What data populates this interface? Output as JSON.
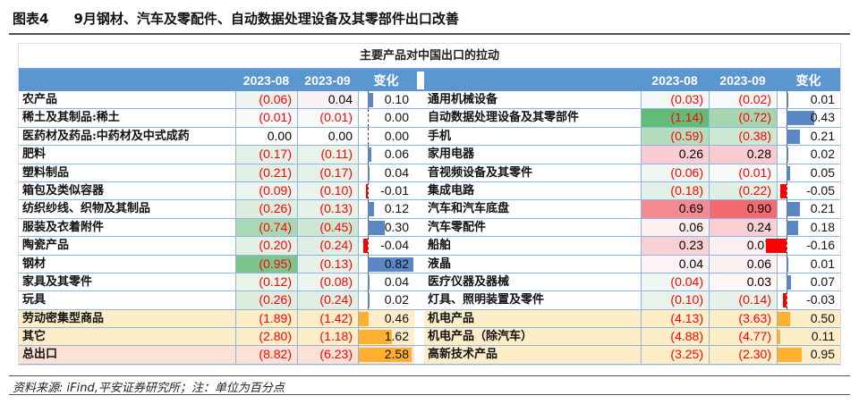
{
  "title": {
    "label": "图表4",
    "text": "9月钢材、汽车及零配件、自动数据处理设备及其零部件出口改善"
  },
  "footer": "资料来源: iFind,平安证券研究所；注：单位为百分点",
  "chart_data": {
    "type": "table",
    "title": "主要产品对中国出口的拉动",
    "columns": [
      "2023-08",
      "2023-09",
      "变化"
    ],
    "left": [
      {
        "name": "农产品",
        "v08": "(0.06)",
        "v09": "0.04",
        "chg": 0.1,
        "chg_text": "0.10",
        "bg08": "#eef5ef",
        "bg09": "#fdf2f3"
      },
      {
        "name": "稀土及其制品:稀土",
        "v08": "(0.01)",
        "v09": "(0.01)",
        "chg": 0.0,
        "chg_text": "0.00",
        "bg08": "#f7faf8",
        "bg09": "#f7faf8"
      },
      {
        "name": "医药材及药品:中药材及中式成药",
        "v08": "0.00",
        "v09": "0.00",
        "chg": 0.0,
        "chg_text": "0.00",
        "bg08": "#fff",
        "bg09": "#fff"
      },
      {
        "name": "肥料",
        "v08": "(0.17)",
        "v09": "(0.11)",
        "chg": 0.06,
        "chg_text": "0.06",
        "bg08": "#e4f1e7",
        "bg09": "#e8f3ea"
      },
      {
        "name": "塑料制品",
        "v08": "(0.21)",
        "v09": "(0.17)",
        "chg": 0.04,
        "chg_text": "0.04",
        "bg08": "#e2f0e5",
        "bg09": "#e4f1e7"
      },
      {
        "name": "箱包及类似容器",
        "v08": "(0.09)",
        "v09": "(0.10)",
        "chg": -0.01,
        "chg_text": "-0.01",
        "bg08": "#ebf4ed",
        "bg09": "#eaf3ec"
      },
      {
        "name": "纺织纱线、织物及其制品",
        "v08": "(0.26)",
        "v09": "(0.13)",
        "chg": 0.12,
        "chg_text": "0.12",
        "bg08": "#ddeee1",
        "bg09": "#e6f2e9"
      },
      {
        "name": "服装及衣着附件",
        "v08": "(0.74)",
        "v09": "(0.45)",
        "chg": 0.3,
        "chg_text": "0.30",
        "bg08": "#a9d8b4",
        "bg09": "#cde7d3"
      },
      {
        "name": "陶瓷产品",
        "v08": "(0.20)",
        "v09": "(0.24)",
        "chg": -0.04,
        "chg_text": "-0.04",
        "bg08": "#e2f0e5",
        "bg09": "#dfefe3"
      },
      {
        "name": "钢材",
        "v08": "(0.95)",
        "v09": "(0.13)",
        "chg": 0.82,
        "chg_text": "0.82",
        "bg08": "#7cc68e",
        "bg09": "#e6f2e9"
      },
      {
        "name": "家具及其零件",
        "v08": "(0.12)",
        "v09": "(0.08)",
        "chg": 0.04,
        "chg_text": "0.04",
        "bg08": "#e8f3ea",
        "bg09": "#edf5ef"
      },
      {
        "name": "玩具",
        "v08": "(0.26)",
        "v09": "(0.24)",
        "chg": 0.02,
        "chg_text": "0.02",
        "bg08": "#ddeee1",
        "bg09": "#dfefe3"
      },
      {
        "name": "劳动密集型商品",
        "v08": "(1.89)",
        "v09": "(1.42)",
        "chg": 0.46,
        "chg_text": "0.46",
        "total": true,
        "rowbg": "#fdeec8"
      },
      {
        "name": "其它",
        "v08": "(2.80)",
        "v09": "(1.18)",
        "chg": 1.62,
        "chg_text": "1.62",
        "total": true,
        "rowbg": "#fdeec8"
      },
      {
        "name": "总出口",
        "v08": "(8.82)",
        "v09": "(6.23)",
        "chg": 2.58,
        "chg_text": "2.58",
        "total": true,
        "rowbg": "#fce1d6"
      }
    ],
    "right": [
      {
        "name": "通用机械设备",
        "v08": "(0.03)",
        "v09": "(0.02)",
        "chg": 0.01,
        "chg_text": "0.01",
        "bg08": "#f4f8f5",
        "bg09": "#f6f9f7"
      },
      {
        "name": "自动数据处理设备及其零部件",
        "v08": "(1.14)",
        "v09": "(0.72)",
        "chg": 0.43,
        "chg_text": "0.43",
        "bg08": "#63bb78",
        "bg09": "#a5d6b0"
      },
      {
        "name": "手机",
        "v08": "(0.59)",
        "v09": "(0.38)",
        "chg": 0.21,
        "chg_text": "0.21",
        "bg08": "#b4ddbe",
        "bg09": "#cce7d2"
      },
      {
        "name": "家用电器",
        "v08": "0.26",
        "v09": "0.28",
        "chg": 0.02,
        "chg_text": "0.02",
        "bg08": "#f9cdd1",
        "bg09": "#f9cbcf"
      },
      {
        "name": "音视频设备及其零件",
        "v08": "(0.06)",
        "v09": "(0.01)",
        "chg": 0.05,
        "chg_text": "0.05",
        "bg08": "#eff6f1",
        "bg09": "#f7faf8"
      },
      {
        "name": "集成电路",
        "v08": "(0.18)",
        "v09": "(0.22)",
        "chg": -0.05,
        "chg_text": "-0.05",
        "bg08": "#e3f0e6",
        "bg09": "#e0efe4"
      },
      {
        "name": "汽车和汽车底盘",
        "v08": "0.69",
        "v09": "0.90",
        "chg": 0.21,
        "chg_text": "0.21",
        "bg08": "#f48b92",
        "bg09": "#f26a72"
      },
      {
        "name": "汽车零配件",
        "v08": "0.06",
        "v09": "0.24",
        "chg": 0.18,
        "chg_text": "0.18",
        "bg08": "#fdf0f1",
        "bg09": "#f9cfd3"
      },
      {
        "name": "船舶",
        "v08": "0.23",
        "v09": "0.07",
        "chg": -0.16,
        "chg_text": "-0.16",
        "bg08": "#f9d0d4",
        "bg09": "#fdeff1"
      },
      {
        "name": "液晶",
        "v08": "0.04",
        "v09": "0.06",
        "chg": 0.01,
        "chg_text": "0.01",
        "bg08": "#fdf3f4",
        "bg09": "#fdf0f1"
      },
      {
        "name": "医疗仪器及器械",
        "v08": "(0.04)",
        "v09": "0.03",
        "chg": 0.07,
        "chg_text": "0.07",
        "bg08": "#f0f7f2",
        "bg09": "#fdf5f6"
      },
      {
        "name": "灯具、照明装置及零件",
        "v08": "(0.10)",
        "v09": "(0.14)",
        "chg": -0.03,
        "chg_text": "-0.03",
        "bg08": "#e9f3eb",
        "bg09": "#e6f2e9"
      },
      {
        "name": "机电产品",
        "v08": "(4.13)",
        "v09": "(3.63)",
        "chg": 0.5,
        "chg_text": "0.50",
        "total": true,
        "rowbg": "#fdeec8"
      },
      {
        "name": "机电产品（除汽车）",
        "v08": "(4.88)",
        "v09": "(4.77)",
        "chg": 0.11,
        "chg_text": "0.11",
        "total": true,
        "rowbg": "#fdeec8"
      },
      {
        "name": "高新技术产品",
        "v08": "(3.25)",
        "v09": "(2.30)",
        "chg": 0.95,
        "chg_text": "0.95",
        "total": true,
        "rowbg": "#fdeec8"
      }
    ],
    "colors": {
      "positive_bar": "#5b87c5",
      "negative_bar": "#ff0000",
      "total_bar": "#ffb02e",
      "header": "#5b96cf"
    }
  }
}
